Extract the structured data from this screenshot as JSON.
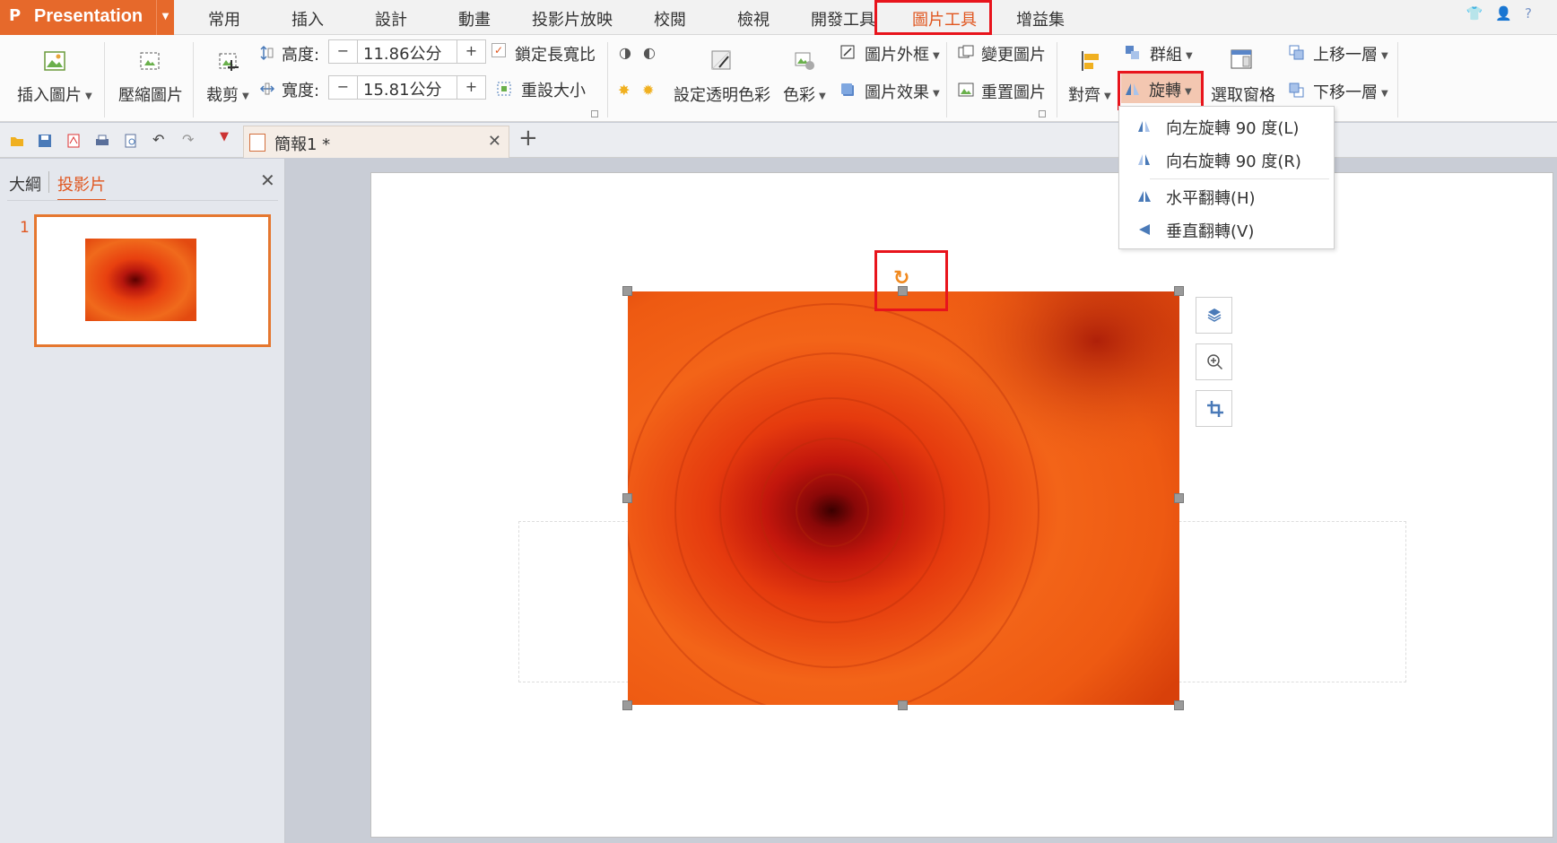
{
  "app": {
    "logo": "P",
    "title": "Presentation"
  },
  "menu_tabs": [
    "常用",
    "插入",
    "設計",
    "動畫",
    "投影片放映",
    "校閱",
    "檢視",
    "開發工具",
    "圖片工具",
    "增益集"
  ],
  "active_menu_tab": "圖片工具",
  "ribbon": {
    "insert_picture": "插入圖片",
    "compress_picture": "壓縮圖片",
    "crop": "裁剪",
    "height_label": "高度:",
    "height_value": "11.86公分",
    "width_label": "寬度:",
    "width_value": "15.81公分",
    "lock_aspect": "鎖定長寬比",
    "reset_size": "重設大小",
    "set_transparent": "設定透明色彩",
    "color": "色彩",
    "picture_border": "圖片外框",
    "picture_effects": "圖片效果",
    "change_picture": "變更圖片",
    "reset_picture": "重置圖片",
    "align": "對齊",
    "group": "群組",
    "rotate": "旋轉",
    "selection_pane": "選取窗格",
    "bring_forward": "上移一層",
    "send_backward": "下移一層",
    "minus": "−",
    "plus": "+"
  },
  "rotate_menu": {
    "items": [
      "向左旋轉 90 度(L)",
      "向右旋轉 90 度(R)",
      "水平翻轉(H)",
      "垂直翻轉(V)"
    ]
  },
  "document_tab": {
    "name": "簡報1 *"
  },
  "left_pane": {
    "tab_outline": "大綱",
    "tab_slides": "投影片",
    "slide_number": "1"
  },
  "colors": {
    "accent": "#e0561f",
    "app_orange": "#e6692b",
    "highlight_red": "#e8141c"
  }
}
